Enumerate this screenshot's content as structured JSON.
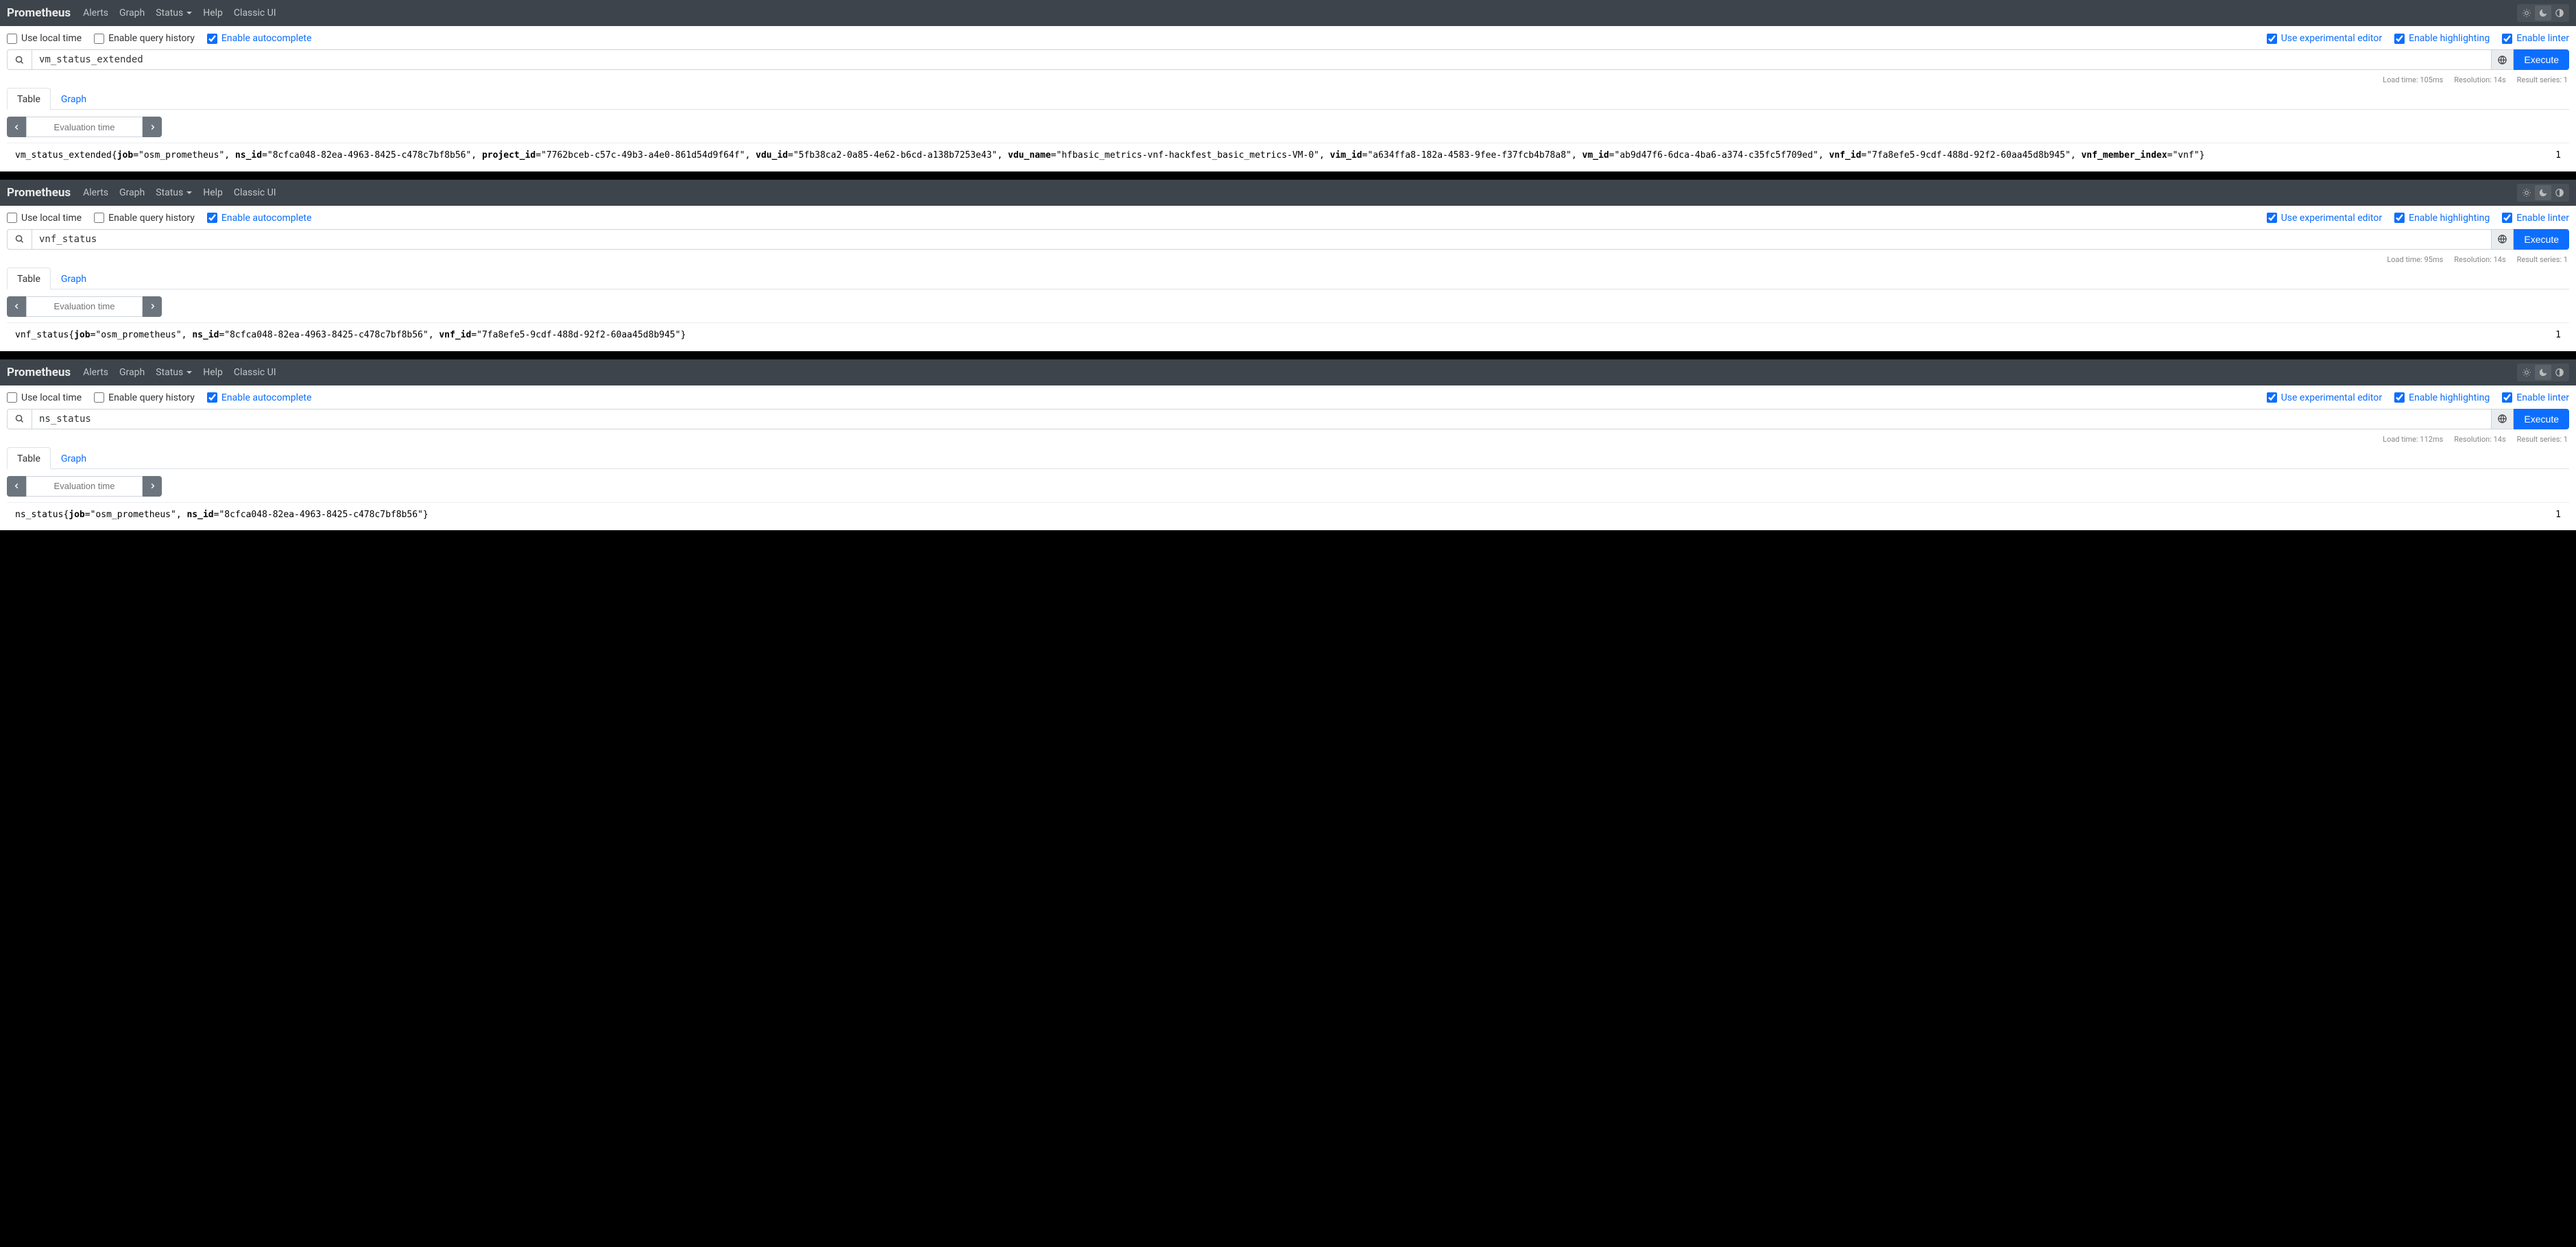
{
  "brand": "Prometheus",
  "nav": {
    "alerts": "Alerts",
    "graph": "Graph",
    "status": "Status",
    "help": "Help",
    "classic": "Classic UI"
  },
  "options": {
    "local_time": "Use local time",
    "query_history": "Enable query history",
    "autocomplete": "Enable autocomplete",
    "experimental_editor": "Use experimental editor",
    "highlighting": "Enable highlighting",
    "linter": "Enable linter"
  },
  "buttons": {
    "execute": "Execute"
  },
  "tabs": {
    "table": "Table",
    "graph": "Graph"
  },
  "eval_placeholder": "Evaluation time",
  "panels": [
    {
      "query": "vm_status_extended",
      "meta": {
        "load": "Load time: 105ms",
        "resolution": "Resolution: 14s",
        "series": "Result series: 1"
      },
      "result": {
        "metric": "vm_status_extended",
        "labels": [
          {
            "k": "job",
            "v": "osm_prometheus"
          },
          {
            "k": "ns_id",
            "v": "8cfca048-82ea-4963-8425-c478c7bf8b56"
          },
          {
            "k": "project_id",
            "v": "7762bceb-c57c-49b3-a4e0-861d54d9f64f"
          },
          {
            "k": "vdu_id",
            "v": "5fb38ca2-0a85-4e62-b6cd-a138b7253e43"
          },
          {
            "k": "vdu_name",
            "v": "hfbasic_metrics-vnf-hackfest_basic_metrics-VM-0"
          },
          {
            "k": "vim_id",
            "v": "a634ffa8-182a-4583-9fee-f37fcb4b78a8"
          },
          {
            "k": "vm_id",
            "v": "ab9d47f6-6dca-4ba6-a374-c35fc5f709ed"
          },
          {
            "k": "vnf_id",
            "v": "7fa8efe5-9cdf-488d-92f2-60aa45d8b945"
          },
          {
            "k": "vnf_member_index",
            "v": "vnf"
          }
        ],
        "value": "1"
      }
    },
    {
      "query": "vnf_status",
      "meta": {
        "load": "Load time: 95ms",
        "resolution": "Resolution: 14s",
        "series": "Result series: 1"
      },
      "result": {
        "metric": "vnf_status",
        "labels": [
          {
            "k": "job",
            "v": "osm_prometheus"
          },
          {
            "k": "ns_id",
            "v": "8cfca048-82ea-4963-8425-c478c7bf8b56"
          },
          {
            "k": "vnf_id",
            "v": "7fa8efe5-9cdf-488d-92f2-60aa45d8b945"
          }
        ],
        "value": "1"
      }
    },
    {
      "query": "ns_status",
      "meta": {
        "load": "Load time: 112ms",
        "resolution": "Resolution: 14s",
        "series": "Result series: 1"
      },
      "result": {
        "metric": "ns_status",
        "labels": [
          {
            "k": "job",
            "v": "osm_prometheus"
          },
          {
            "k": "ns_id",
            "v": "8cfca048-82ea-4963-8425-c478c7bf8b56"
          }
        ],
        "value": "1"
      }
    }
  ]
}
